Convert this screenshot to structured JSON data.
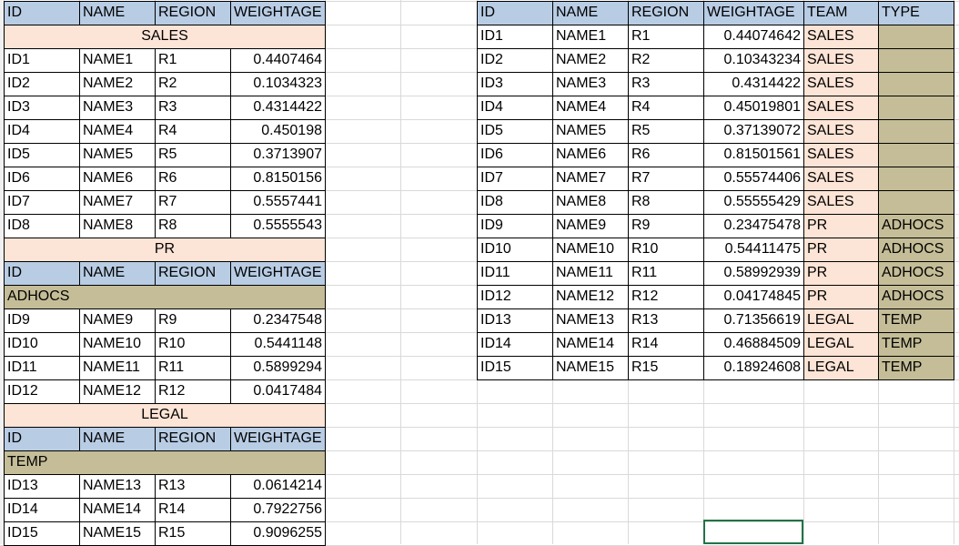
{
  "colors": {
    "header": "#b8cce4",
    "team": "#fce4d6",
    "type": "#c4bd97",
    "selection": "#217346"
  },
  "left_table": {
    "headers": [
      "ID",
      "NAME",
      "REGION",
      "WEIGHTAGE"
    ],
    "sections": [
      {
        "team": "SALES",
        "type": null,
        "show_header": false,
        "rows": [
          [
            "ID1",
            "NAME1",
            "R1",
            "0.4407464"
          ],
          [
            "ID2",
            "NAME2",
            "R2",
            "0.1034323"
          ],
          [
            "ID3",
            "NAME3",
            "R3",
            "0.4314422"
          ],
          [
            "ID4",
            "NAME4",
            "R4",
            "0.450198"
          ],
          [
            "ID5",
            "NAME5",
            "R5",
            "0.3713907"
          ],
          [
            "ID6",
            "NAME6",
            "R6",
            "0.8150156"
          ],
          [
            "ID7",
            "NAME7",
            "R7",
            "0.5557441"
          ],
          [
            "ID8",
            "NAME8",
            "R8",
            "0.5555543"
          ]
        ]
      },
      {
        "team": "PR",
        "type": "ADHOCS",
        "show_header": true,
        "rows": [
          [
            "ID9",
            "NAME9",
            "R9",
            "0.2347548"
          ],
          [
            "ID10",
            "NAME10",
            "R10",
            "0.5441148"
          ],
          [
            "ID11",
            "NAME11",
            "R11",
            "0.5899294"
          ],
          [
            "ID12",
            "NAME12",
            "R12",
            "0.0417484"
          ]
        ]
      },
      {
        "team": "LEGAL",
        "type": "TEMP",
        "show_header": true,
        "rows": [
          [
            "ID13",
            "NAME13",
            "R13",
            "0.0614214"
          ],
          [
            "ID14",
            "NAME14",
            "R14",
            "0.7922756"
          ],
          [
            "ID15",
            "NAME15",
            "R15",
            "0.9096255"
          ]
        ]
      }
    ]
  },
  "right_table": {
    "headers": [
      "ID",
      "NAME",
      "REGION",
      "WEIGHTAGE",
      "TEAM",
      "TYPE"
    ],
    "rows": [
      [
        "ID1",
        "NAME1",
        "R1",
        "0.44074642",
        "SALES",
        ""
      ],
      [
        "ID2",
        "NAME2",
        "R2",
        "0.10343234",
        "SALES",
        ""
      ],
      [
        "ID3",
        "NAME3",
        "R3",
        "0.4314422",
        "SALES",
        ""
      ],
      [
        "ID4",
        "NAME4",
        "R4",
        "0.45019801",
        "SALES",
        ""
      ],
      [
        "ID5",
        "NAME5",
        "R5",
        "0.37139072",
        "SALES",
        ""
      ],
      [
        "ID6",
        "NAME6",
        "R6",
        "0.81501561",
        "SALES",
        ""
      ],
      [
        "ID7",
        "NAME7",
        "R7",
        "0.55574406",
        "SALES",
        ""
      ],
      [
        "ID8",
        "NAME8",
        "R8",
        "0.55555429",
        "SALES",
        ""
      ],
      [
        "ID9",
        "NAME9",
        "R9",
        "0.23475478",
        "PR",
        "ADHOCS"
      ],
      [
        "ID10",
        "NAME10",
        "R10",
        "0.54411475",
        "PR",
        "ADHOCS"
      ],
      [
        "ID11",
        "NAME11",
        "R11",
        "0.58992939",
        "PR",
        "ADHOCS"
      ],
      [
        "ID12",
        "NAME12",
        "R12",
        "0.04174845",
        "PR",
        "ADHOCS"
      ],
      [
        "ID13",
        "NAME13",
        "R13",
        "0.71356619",
        "LEGAL",
        "TEMP"
      ],
      [
        "ID14",
        "NAME14",
        "R14",
        "0.46884509",
        "LEGAL",
        "TEMP"
      ],
      [
        "ID15",
        "NAME15",
        "R15",
        "0.18924608",
        "LEGAL",
        "TEMP"
      ]
    ]
  }
}
